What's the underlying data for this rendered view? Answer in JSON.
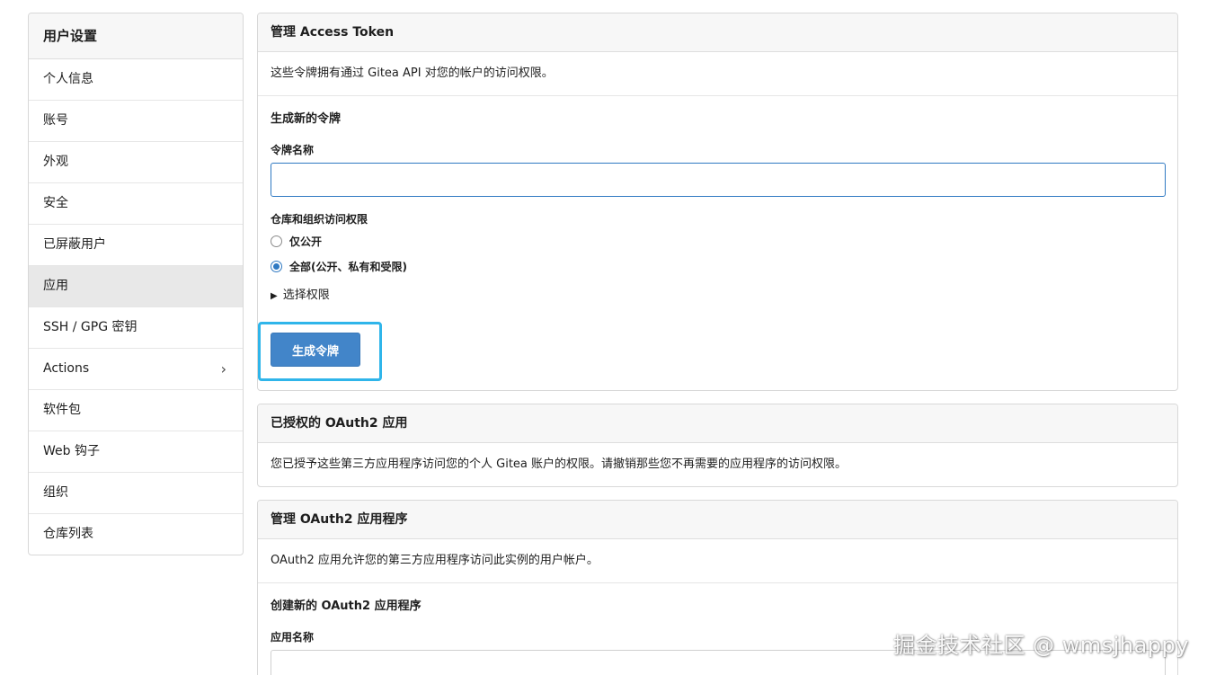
{
  "sidebar": {
    "title": "用户设置",
    "items": [
      {
        "label": "个人信息",
        "active": false
      },
      {
        "label": "账号",
        "active": false
      },
      {
        "label": "外观",
        "active": false
      },
      {
        "label": "安全",
        "active": false
      },
      {
        "label": "已屏蔽用户",
        "active": false
      },
      {
        "label": "应用",
        "active": true
      },
      {
        "label": "SSH / GPG 密钥",
        "active": false
      },
      {
        "label": "Actions",
        "active": false,
        "chevron": "›"
      },
      {
        "label": "软件包",
        "active": false
      },
      {
        "label": "Web 钩子",
        "active": false
      },
      {
        "label": "组织",
        "active": false
      },
      {
        "label": "仓库列表",
        "active": false
      }
    ]
  },
  "access_token": {
    "title": "管理 Access Token",
    "description": "这些令牌拥有通过 Gitea API 对您的帐户的访问权限。",
    "form_title": "生成新的令牌",
    "name_label": "令牌名称",
    "name_value": "",
    "scope_label": "仓库和组织访问权限",
    "radio_public": "仅公开",
    "radio_all": "全部(公开、私有和受限)",
    "selected_scope": "all",
    "details_toggle": "选择权限",
    "details_icon": "▶",
    "submit_label": "生成令牌"
  },
  "authorized_oauth": {
    "title": "已授权的 OAuth2 应用",
    "description": "您已授予这些第三方应用程序访问您的个人 Gitea 账户的权限。请撤销那些您不再需要的应用程序的访问权限。"
  },
  "manage_oauth": {
    "title": "管理 OAuth2 应用程序",
    "description": "OAuth2 应用允许您的第三方应用程序访问此实例的用户帐户。",
    "form_title": "创建新的 OAuth2 应用程序",
    "name_label": "应用名称",
    "name_value": ""
  },
  "watermark": "掘金技术社区 @ wmsjhappy",
  "colors": {
    "primary": "#4285c9",
    "focus_ring": "#2fb5ea",
    "input_focus_border": "#2f79c2",
    "active_sidebar_bg": "#e8e8e8"
  }
}
